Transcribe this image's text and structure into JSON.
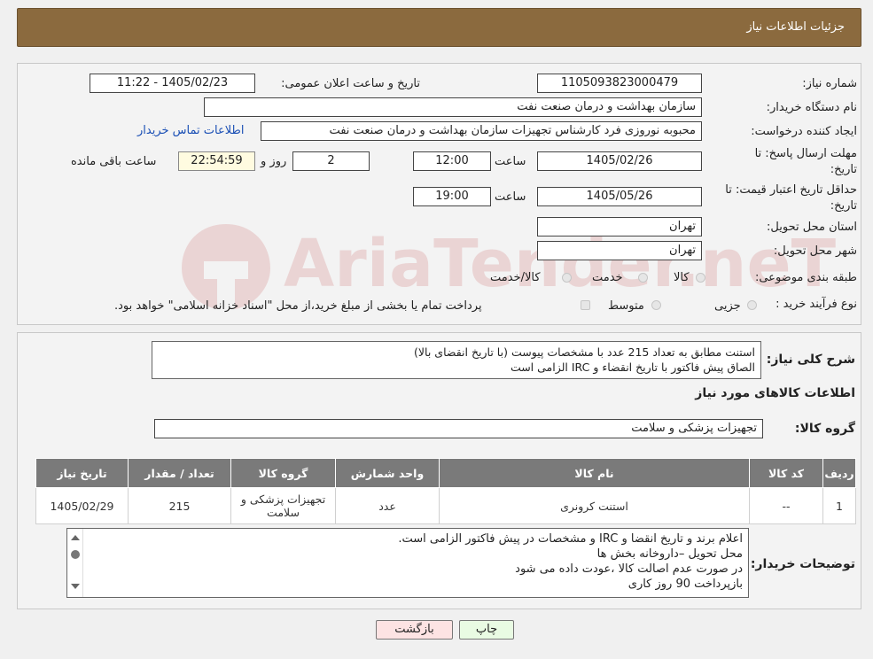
{
  "header": {
    "title": "جزئیات اطلاعات نیاز"
  },
  "watermark": {
    "text": "AriaTender.neT"
  },
  "form": {
    "need_number_label": "شماره نیاز:",
    "need_number": "1105093823000479",
    "announce_label": "تاریخ و ساعت اعلان عمومی:",
    "announce_value": "1405/02/23 - 11:22",
    "buyer_org_label": "نام دستگاه خریدار:",
    "buyer_org": "سازمان بهداشت و درمان صنعت نفت",
    "requester_label": "ایجاد کننده درخواست:",
    "requester": "محبوبه نوروزی فرد کارشناس تجهیزات سازمان بهداشت و درمان صنعت نفت",
    "contact_link": "اطلاعات تماس خریدار",
    "deadline_label_1": "مهلت ارسال پاسخ: تا",
    "deadline_label_2": "تاریخ:",
    "deadline_date": "1405/02/26",
    "time_label": "ساعت",
    "deadline_time": "12:00",
    "days_value": "2",
    "days_label": "روز و",
    "remaining_time": "22:54:59",
    "remaining_label": "ساعت باقی مانده",
    "validity_label_1": "حداقل تاریخ اعتبار قیمت: تا",
    "validity_label_2": "تاریخ:",
    "validity_date": "1405/05/26",
    "validity_time": "19:00",
    "province_label": "استان محل تحویل:",
    "province": "تهران",
    "city_label": "شهر محل تحویل:",
    "city": "تهران",
    "category_label": "طبقه بندی موضوعی:",
    "category_options": [
      "کالا",
      "خدمت",
      "کالا/خدمت"
    ],
    "process_label": "نوع فرآیند خرید :",
    "process_options": [
      "جزیی",
      "متوسط"
    ],
    "process_note": "پرداخت تمام یا بخشی از مبلغ خرید،از محل \"اسناد خزانه اسلامی\" خواهد بود."
  },
  "description": {
    "label": "شرح کلی نیاز:",
    "line1": "استنت مطابق به تعداد 215 عدد با مشخصات پیوست (با تاریخ انقضای بالا)",
    "line2": "الصاق پیش فاکتور با تاریخ انقضاء و IRC الزامی است"
  },
  "goods": {
    "section_title": "اطلاعات کالاهای مورد نیاز",
    "group_label": "گروه کالا:",
    "group_value": "تجهیزات پزشکی و سلامت",
    "columns": [
      "ردیف",
      "کد کالا",
      "نام کالا",
      "واحد شمارش",
      "گروه کالا",
      "تعداد / مقدار",
      "تاریخ نیاز"
    ],
    "rows": [
      {
        "row": "1",
        "code": "--",
        "name": "استنت کرونری",
        "unit": "عدد",
        "group": "تجهیزات پزشکی و سلامت",
        "qty": "215",
        "date": "1405/02/29"
      }
    ]
  },
  "buyer_notes": {
    "label": "توضیحات خریدار:",
    "lines": [
      "اعلام برند و تاریخ انقضا  و IRC  و مشخصات در پیش فاکتور الزامی است.",
      "محل تحویل –داروخانه بخش ها",
      "در صورت عدم اصالت کالا ،عودت داده می شود",
      "بازپرداخت 90 روز کاری"
    ]
  },
  "buttons": {
    "print": "چاپ",
    "back": "بازگشت"
  },
  "colors": {
    "header_bg": "#8b6a3e",
    "back_button_bg": "#fde3e3",
    "print_button_bg": "#e9fbe3",
    "table_header_bg": "#7a7a7a"
  }
}
